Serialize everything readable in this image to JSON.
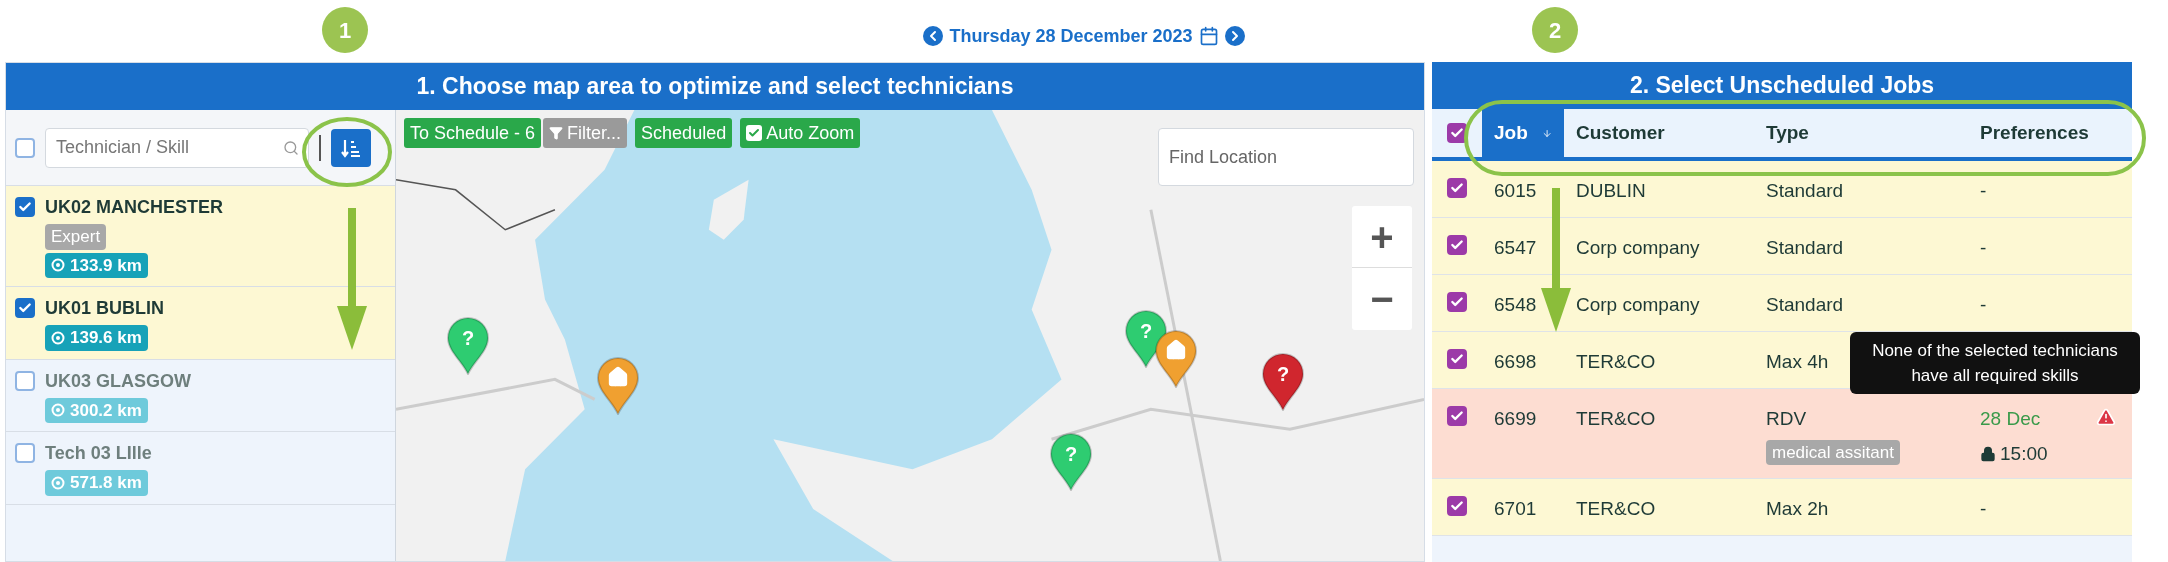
{
  "date_nav": {
    "date": "Thursday 28 December 2023"
  },
  "left_panel": {
    "badge": "1",
    "title": "1. Choose map area to optimize and select technicians",
    "select_all": {
      "checked": false
    },
    "search": {
      "placeholder": "Technician / Skill"
    },
    "technicians": [
      {
        "name": "UK02 MANCHESTER",
        "checked": true,
        "skills": [
          "Expert"
        ],
        "distance": "133.9 km"
      },
      {
        "name": "UK01 BUBLIN",
        "checked": true,
        "distance": "139.6 km"
      },
      {
        "name": "UK03 GLASGOW",
        "checked": false,
        "distance": "300.2 km"
      },
      {
        "name": "Tech 03 LIlle",
        "checked": false,
        "distance": "571.8 km"
      }
    ]
  },
  "map": {
    "buttons": [
      {
        "kind": "count",
        "label": "To Schedule - 6"
      },
      {
        "kind": "filter",
        "label": "Filter..."
      },
      {
        "kind": "plain",
        "label": "Scheduled"
      },
      {
        "kind": "toggle",
        "label": "Auto Zoom",
        "checked": true
      }
    ],
    "location_search": {
      "placeholder": "Find Location"
    },
    "zoom": {
      "in": "+",
      "out": "−"
    },
    "markers": [
      {
        "kind": "job",
        "symbol": "?",
        "color": "#2ecc71"
      },
      {
        "kind": "home",
        "color": "#f0a030"
      },
      {
        "kind": "job",
        "symbol": "?",
        "color": "#2ecc71"
      },
      {
        "kind": "home",
        "color": "#f0a030"
      },
      {
        "kind": "job",
        "symbol": "?",
        "color": "#d0262e"
      },
      {
        "kind": "job",
        "symbol": "?",
        "color": "#2ecc71"
      }
    ]
  },
  "right_panel": {
    "badge": "2",
    "title": "2. Select Unscheduled Jobs",
    "select_all": {
      "checked": true
    },
    "columns": [
      {
        "label": "Job",
        "sorted": true
      },
      {
        "label": "Customer",
        "sorted": false
      },
      {
        "label": "Type",
        "sorted": false
      },
      {
        "label": "Preferences",
        "sorted": false
      }
    ],
    "jobs": [
      {
        "job": "6015",
        "customer": "DUBLIN",
        "type": "Standard",
        "preference": "-",
        "checked": true,
        "warning": false
      },
      {
        "job": "6547",
        "customer": "Corp company",
        "type": "Standard",
        "preference": "-",
        "checked": true,
        "warning": false
      },
      {
        "job": "6548",
        "customer": "Corp company",
        "type": "Standard",
        "preference": "-",
        "checked": true,
        "warning": false
      },
      {
        "job": "6698",
        "customer": "TER&CO",
        "type": "Max 4h",
        "checked": true,
        "warning": false
      },
      {
        "job": "6699",
        "customer": "TER&CO",
        "type": "RDV",
        "skills": [
          "medical assitant"
        ],
        "preference_date": "28 Dec",
        "preference_time": "15:00",
        "locked": true,
        "checked": true,
        "warning": true
      },
      {
        "job": "6701",
        "customer": "TER&CO",
        "type": "Max 2h",
        "preference": "-",
        "checked": true,
        "warning": false
      }
    ],
    "tooltip": "None of the selected technicians have all required skills"
  }
}
